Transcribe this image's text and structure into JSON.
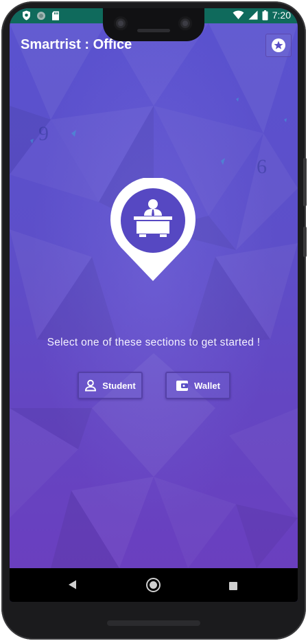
{
  "status_bar": {
    "time": "7:20",
    "left_icons": [
      "shield-icon",
      "circle-icon",
      "sd-card-icon"
    ],
    "right_icons": [
      "wifi-icon",
      "signal-icon",
      "battery-icon"
    ]
  },
  "app_bar": {
    "title": "Smartrist : Office",
    "action_icon": "star-badge-icon"
  },
  "main": {
    "hero_icon": "office-desk-pin-icon",
    "prompt": "Select one of these sections to get started !",
    "buttons": [
      {
        "label": "Student",
        "icon": "person-icon"
      },
      {
        "label": "Wallet",
        "icon": "wallet-icon"
      }
    ]
  },
  "nav_bar": {
    "items": [
      "back-icon",
      "home-icon",
      "recents-icon"
    ]
  },
  "colors": {
    "status_bar": "#0f6a5c",
    "background_top": "#5a52cf",
    "background_bottom": "#6a3fbf",
    "text": "#ffffff"
  }
}
